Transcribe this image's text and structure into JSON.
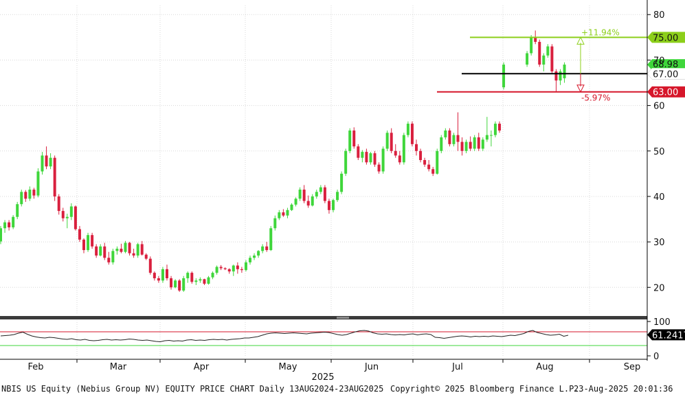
{
  "chart_data": {
    "type": "candlestick",
    "title": "NBIS US Equity (Nebius Group NV) EQUITY PRICE CHART",
    "period": "Daily 13AUG2024-23AUG2025",
    "x_month_labels": [
      "Feb",
      "Mar",
      "Apr",
      "May",
      "Jun",
      "Jul",
      "Aug",
      "Sep"
    ],
    "x_year_label": "2025",
    "price_axis": {
      "ylim": [
        14,
        82
      ],
      "ticks": [
        20,
        30,
        40,
        50,
        60,
        70,
        80
      ]
    },
    "rsi_axis": {
      "ylim": [
        -4,
        104
      ],
      "ticks": [
        0,
        100
      ]
    },
    "grid": true,
    "levels": [
      {
        "value": 75.0,
        "label": "75.00",
        "color": "#8ccf1a"
      },
      {
        "value": 67.0,
        "label": "67.00",
        "color": "#000000"
      },
      {
        "value": 63.0,
        "label": "63.00",
        "color": "#d6162a"
      }
    ],
    "last_price_label": "68.98",
    "range_annotations": [
      {
        "text": "+11.94%",
        "color": "#8ccf1a"
      },
      {
        "text": "-5.97%",
        "color": "#d6162a"
      }
    ],
    "rsi": {
      "last_value_label": "61.2417",
      "overbought": 70,
      "oversold": 30,
      "values": [
        58,
        59,
        60,
        62,
        66,
        69,
        63,
        58,
        55,
        53,
        52,
        54,
        53,
        51,
        49,
        48,
        50,
        47,
        46,
        48,
        45,
        44,
        45,
        47,
        48,
        46,
        47,
        46,
        47,
        49,
        48,
        46,
        45,
        46,
        44,
        42,
        41,
        44,
        45,
        43,
        44,
        43,
        46,
        47,
        45,
        46,
        45,
        47,
        48,
        47,
        48,
        46,
        48,
        49,
        50,
        52,
        52,
        54,
        56,
        60,
        64,
        66,
        67,
        66,
        65,
        66,
        67,
        66,
        65,
        64,
        66,
        67,
        68,
        69,
        68,
        65,
        62,
        60,
        62,
        66,
        70,
        73,
        74,
        72,
        67,
        64,
        63,
        64,
        62,
        61,
        62,
        61,
        63,
        64,
        61,
        63,
        64,
        62,
        54,
        53,
        51,
        53,
        55,
        57,
        58,
        57,
        55,
        57,
        56,
        57,
        56,
        58,
        57,
        56,
        58,
        60,
        59,
        62,
        65,
        71,
        74,
        68,
        65,
        62,
        60,
        61,
        63,
        57,
        60
      ]
    },
    "candles": [
      [
        30.1,
        33.5,
        29.5,
        33.0
      ],
      [
        33.0,
        34.8,
        32.0,
        34.3
      ],
      [
        34.3,
        34.8,
        32.5,
        33.2
      ],
      [
        33.2,
        35.9,
        32.8,
        35.5
      ],
      [
        35.5,
        38.8,
        35.0,
        38.3
      ],
      [
        38.3,
        41.5,
        37.8,
        41.0
      ],
      [
        41.0,
        41.4,
        38.8,
        39.5
      ],
      [
        39.5,
        42.2,
        39.0,
        41.5
      ],
      [
        41.5,
        41.9,
        39.5,
        40.2
      ],
      [
        40.2,
        46.2,
        39.8,
        45.5
      ],
      [
        45.5,
        49.8,
        44.8,
        49.0
      ],
      [
        49.0,
        51.0,
        46.0,
        46.6
      ],
      [
        46.6,
        49.5,
        46.0,
        48.5
      ],
      [
        48.5,
        49.0,
        39.0,
        40.0
      ],
      [
        40.0,
        40.5,
        36.0,
        36.8
      ],
      [
        36.8,
        37.5,
        34.5,
        35.2
      ],
      [
        35.2,
        36.2,
        33.0,
        35.5
      ],
      [
        35.5,
        38.5,
        34.8,
        37.8
      ],
      [
        37.8,
        38.0,
        32.5,
        32.8
      ],
      [
        32.8,
        33.5,
        30.0,
        30.5
      ],
      [
        30.5,
        30.8,
        27.5,
        28.2
      ],
      [
        28.2,
        32.0,
        27.8,
        31.5
      ],
      [
        31.5,
        32.0,
        28.5,
        29.0
      ],
      [
        29.0,
        29.5,
        26.5,
        27.0
      ],
      [
        27.0,
        29.5,
        26.8,
        29.0
      ],
      [
        29.0,
        29.8,
        26.0,
        26.5
      ],
      [
        26.5,
        27.8,
        25.0,
        25.5
      ],
      [
        25.5,
        28.5,
        25.0,
        28.0
      ],
      [
        28.0,
        29.0,
        27.2,
        28.5
      ],
      [
        28.5,
        29.6,
        27.5,
        27.8
      ],
      [
        27.8,
        30.2,
        27.5,
        29.8
      ],
      [
        29.8,
        30.0,
        27.0,
        27.5
      ],
      [
        27.5,
        28.5,
        26.5,
        27.0
      ],
      [
        27.0,
        29.8,
        26.5,
        29.5
      ],
      [
        29.5,
        30.2,
        27.0,
        27.2
      ],
      [
        27.2,
        27.5,
        26.0,
        26.3
      ],
      [
        26.3,
        26.8,
        22.8,
        23.2
      ],
      [
        23.2,
        23.5,
        21.5,
        22.0
      ],
      [
        22.0,
        22.5,
        21.0,
        21.5
      ],
      [
        21.5,
        24.5,
        21.0,
        24.0
      ],
      [
        24.0,
        25.0,
        21.5,
        22.0
      ],
      [
        22.0,
        22.5,
        19.5,
        20.0
      ],
      [
        20.0,
        21.8,
        19.8,
        21.5
      ],
      [
        21.5,
        21.8,
        19.0,
        19.3
      ],
      [
        19.3,
        22.5,
        19.0,
        22.0
      ],
      [
        22.0,
        23.5,
        21.0,
        23.2
      ],
      [
        23.2,
        23.5,
        20.8,
        21.2
      ],
      [
        21.2,
        22.0,
        20.5,
        21.5
      ],
      [
        21.5,
        22.2,
        21.0,
        21.8
      ],
      [
        21.8,
        21.9,
        20.5,
        20.8
      ],
      [
        20.8,
        22.5,
        20.6,
        22.2
      ],
      [
        22.2,
        23.5,
        21.8,
        23.2
      ],
      [
        23.2,
        24.8,
        22.8,
        24.5
      ],
      [
        24.5,
        24.9,
        23.8,
        24.2
      ],
      [
        24.2,
        24.4,
        23.8,
        24.0
      ],
      [
        24.0,
        24.2,
        23.0,
        23.5
      ],
      [
        23.5,
        25.0,
        22.5,
        24.8
      ],
      [
        24.8,
        25.5,
        23.0,
        24.0
      ],
      [
        24.0,
        24.5,
        23.2,
        23.8
      ],
      [
        23.8,
        26.0,
        23.5,
        25.5
      ],
      [
        25.5,
        27.0,
        25.0,
        26.5
      ],
      [
        26.5,
        27.5,
        26.0,
        27.0
      ],
      [
        27.0,
        28.2,
        26.5,
        28.0
      ],
      [
        28.0,
        29.5,
        27.5,
        29.0
      ],
      [
        29.0,
        30.0,
        27.8,
        28.2
      ],
      [
        28.2,
        33.5,
        28.0,
        33.0
      ],
      [
        33.0,
        35.8,
        32.5,
        35.2
      ],
      [
        35.2,
        37.0,
        34.8,
        36.5
      ],
      [
        36.5,
        37.2,
        35.5,
        35.8
      ],
      [
        35.8,
        37.5,
        35.2,
        37.0
      ],
      [
        37.0,
        38.5,
        36.8,
        38.2
      ],
      [
        38.2,
        39.8,
        37.8,
        39.5
      ],
      [
        39.5,
        42.0,
        39.0,
        41.5
      ],
      [
        41.5,
        42.5,
        38.5,
        39.0
      ],
      [
        39.0,
        40.2,
        37.5,
        38.0
      ],
      [
        38.0,
        40.5,
        37.8,
        40.0
      ],
      [
        40.0,
        41.5,
        39.5,
        41.0
      ],
      [
        41.0,
        42.5,
        40.5,
        42.0
      ],
      [
        42.0,
        42.5,
        38.5,
        39.0
      ],
      [
        39.0,
        39.5,
        36.2,
        37.0
      ],
      [
        37.0,
        39.5,
        36.5,
        39.2
      ],
      [
        39.2,
        41.5,
        38.8,
        41.0
      ],
      [
        41.0,
        45.5,
        40.5,
        45.0
      ],
      [
        45.0,
        50.5,
        44.5,
        50.0
      ],
      [
        50.0,
        55.0,
        49.5,
        54.5
      ],
      [
        54.5,
        55.2,
        50.5,
        51.0
      ],
      [
        51.0,
        51.5,
        48.0,
        48.5
      ],
      [
        48.5,
        50.2,
        47.5,
        49.8
      ],
      [
        49.8,
        50.5,
        47.0,
        47.5
      ],
      [
        47.5,
        49.8,
        47.0,
        49.5
      ],
      [
        49.5,
        50.0,
        46.5,
        47.0
      ],
      [
        47.0,
        47.5,
        45.0,
        45.5
      ],
      [
        45.5,
        51.0,
        45.0,
        50.5
      ],
      [
        50.5,
        54.5,
        50.0,
        54.0
      ],
      [
        54.0,
        55.0,
        49.5,
        50.0
      ],
      [
        50.0,
        51.5,
        48.5,
        49.0
      ],
      [
        49.0,
        50.0,
        47.0,
        47.5
      ],
      [
        47.5,
        54.0,
        47.0,
        53.5
      ],
      [
        53.5,
        56.5,
        53.0,
        56.0
      ],
      [
        56.0,
        56.5,
        51.0,
        51.5
      ],
      [
        51.5,
        52.5,
        49.0,
        50.0
      ],
      [
        50.0,
        50.5,
        47.5,
        48.0
      ],
      [
        48.0,
        48.5,
        46.5,
        47.0
      ],
      [
        47.0,
        48.0,
        45.5,
        46.0
      ],
      [
        46.0,
        46.5,
        44.5,
        45.0
      ],
      [
        45.0,
        50.5,
        44.8,
        50.0
      ],
      [
        50.0,
        53.5,
        49.5,
        53.0
      ],
      [
        53.0,
        55.0,
        52.5,
        54.5
      ],
      [
        54.5,
        55.0,
        51.0,
        51.5
      ],
      [
        51.5,
        54.0,
        51.0,
        53.5
      ],
      [
        53.5,
        58.5,
        50.0,
        52.0
      ],
      [
        52.0,
        53.0,
        49.0,
        50.0
      ],
      [
        50.0,
        52.5,
        49.5,
        52.0
      ],
      [
        52.0,
        53.2,
        50.0,
        50.5
      ],
      [
        50.5,
        53.5,
        50.0,
        53.0
      ],
      [
        53.0,
        54.0,
        50.0,
        50.5
      ],
      [
        50.5,
        53.0,
        50.0,
        52.5
      ],
      [
        52.5,
        57.5,
        52.0,
        53.5
      ],
      [
        53.5,
        54.5,
        51.0,
        53.5
      ],
      [
        53.5,
        56.5,
        53.0,
        56.0
      ],
      [
        56.0,
        56.5,
        54.0,
        54.5
      ],
      [
        64.0,
        69.5,
        63.5,
        69.0
      ],
      [
        69.0,
        72.0,
        68.5,
        71.5
      ],
      [
        71.5,
        75.5,
        71.0,
        75.0
      ],
      [
        75.0,
        76.5,
        73.5,
        74.0
      ],
      [
        74.0,
        74.5,
        68.5,
        69.0
      ],
      [
        69.0,
        71.5,
        67.5,
        71.0
      ],
      [
        71.0,
        73.5,
        70.5,
        73.0
      ],
      [
        73.0,
        73.5,
        67.0,
        67.5
      ],
      [
        67.5,
        68.0,
        63.0,
        65.5
      ],
      [
        65.5,
        68.0,
        64.5,
        67.5
      ],
      [
        66.0,
        69.5,
        65.0,
        69.0
      ]
    ]
  },
  "footer": {
    "left": "NBIS US Equity (Nebius Group NV) EQUITY PRICE CHART  Daily 13AUG2024-23AUG2025",
    "center": "Copyright© 2025 Bloomberg Finance L.P.",
    "right": "23-Aug-2025 20:01:36"
  }
}
